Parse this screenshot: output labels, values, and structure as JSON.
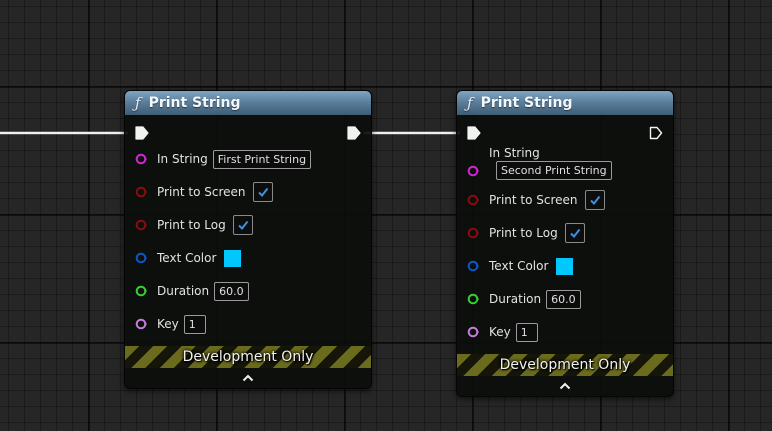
{
  "colors": {
    "exec": "#f2f2f2",
    "string_pin": "#d325d3",
    "bool_pin": "#8c0c0c",
    "struct_pin": "#0b58c9",
    "float_pin": "#35d033",
    "name_pin": "#c67bdc",
    "text_color_value": "#00c8ff"
  },
  "nodes": [
    {
      "title": "Print String",
      "icon": "function-icon",
      "in_string_label": "In String",
      "in_string_value": "First Print String",
      "print_to_screen_label": "Print to Screen",
      "print_to_screen_checked": true,
      "print_to_log_label": "Print to Log",
      "print_to_log_checked": true,
      "text_color_label": "Text Color",
      "duration_label": "Duration",
      "duration_value": "60.0",
      "key_label": "Key",
      "key_value": "1",
      "banner": "Development Only"
    },
    {
      "title": "Print String",
      "icon": "function-icon",
      "in_string_label": "In String",
      "in_string_value": "Second Print String",
      "print_to_screen_label": "Print to Screen",
      "print_to_screen_checked": true,
      "print_to_log_label": "Print to Log",
      "print_to_log_checked": true,
      "text_color_label": "Text Color",
      "duration_label": "Duration",
      "duration_value": "60.0",
      "key_label": "Key",
      "key_value": "1",
      "banner": "Development Only"
    }
  ]
}
